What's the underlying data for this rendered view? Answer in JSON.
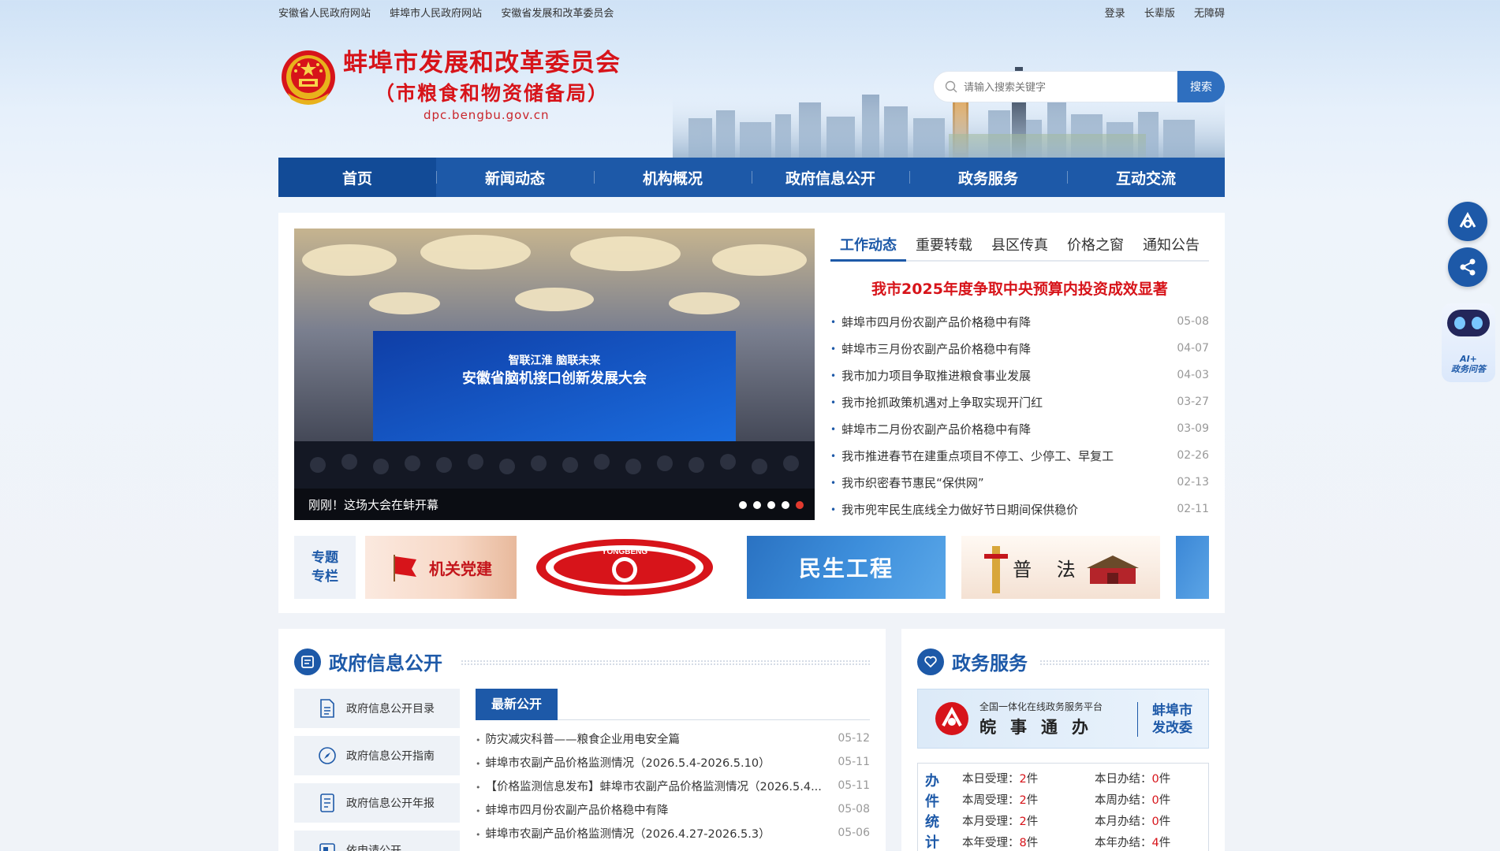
{
  "topbar": {
    "links": [
      "安徽省人民政府网站",
      "蚌埠市人民政府网站",
      "安徽省发展和改革委员会"
    ],
    "login": "登录",
    "elder": "长辈版",
    "accessibility": "无障碍"
  },
  "header": {
    "title": "蚌埠市发展和改革委员会",
    "subtitle": "（市粮食和物资储备局）",
    "domain": "dpc.bengbu.gov.cn",
    "search_placeholder": "请输入搜索关键字",
    "search_button": "搜索"
  },
  "nav": {
    "items": [
      "首页",
      "新闻动态",
      "机构概况",
      "政府信息公开",
      "政务服务",
      "互动交流"
    ],
    "active": 0
  },
  "slider": {
    "caption": "刚刚！这场大会在蚌开幕",
    "screen_line1": "智联江淮  脑联未来",
    "screen_line2": "安徽省脑机接口创新发展大会",
    "dot_count": 5,
    "active_dot": 4
  },
  "news": {
    "tabs": [
      "工作动态",
      "重要转载",
      "县区传真",
      "价格之窗",
      "通知公告"
    ],
    "active_tab": 0,
    "headline": "我市2025年度争取中央预算内投资成效显著",
    "items": [
      {
        "title": "蚌埠市四月份农副产品价格稳中有降",
        "date": "05-08"
      },
      {
        "title": "蚌埠市三月份农副产品价格稳中有降",
        "date": "04-07"
      },
      {
        "title": "我市加力项目争取推进粮食事业发展",
        "date": "04-03"
      },
      {
        "title": "我市抢抓政策机遇对上争取实现开门红",
        "date": "03-27"
      },
      {
        "title": "蚌埠市二月份农副产品价格稳中有降",
        "date": "03-09"
      },
      {
        "title": "我市推进春节在建重点项目不停工、少停工、早复工",
        "date": "02-26"
      },
      {
        "title": "我市织密春节惠民“保供网”",
        "date": "02-13"
      },
      {
        "title": "我市兜牢民生底线全力做好节日期间保供稳价",
        "date": "02-11"
      }
    ]
  },
  "special": {
    "label_line1": "专题",
    "label_line2": "专栏",
    "banners": [
      "机关党建",
      "YONGBENG",
      "民生工程",
      "普 法"
    ]
  },
  "gov_info": {
    "title": "政府信息公开",
    "side": [
      "政府信息公开目录",
      "政府信息公开指南",
      "政府信息公开年报",
      "依申请公开"
    ],
    "latest_tab": "最新公开",
    "items": [
      {
        "title": "防灾减灾科普——粮食企业用电安全篇",
        "date": "05-12"
      },
      {
        "title": "蚌埠市农副产品价格监测情况（2026.5.4-2026.5.10）",
        "date": "05-11"
      },
      {
        "title": "【价格监测信息发布】蚌埠市农副产品价格监测情况（2026.5.4...",
        "date": "05-11"
      },
      {
        "title": "蚌埠市四月份农副产品价格稳中有降",
        "date": "05-08"
      },
      {
        "title": "蚌埠市农副产品价格监测情况（2026.4.27-2026.5.3）",
        "date": "05-06"
      }
    ]
  },
  "service": {
    "title": "政务服务",
    "platform_small": "全国一体化在线政务服务平台",
    "platform_big": "皖事通办",
    "city_line1": "蚌埠市",
    "city_line2": "发改委",
    "stats_label": "办件统计",
    "stats": [
      {
        "label": "本日受理：",
        "value": "2",
        "unit": "件"
      },
      {
        "label": "本日办结：",
        "value": "0",
        "unit": "件"
      },
      {
        "label": "本周受理：",
        "value": "2",
        "unit": "件"
      },
      {
        "label": "本周办结：",
        "value": "0",
        "unit": "件"
      },
      {
        "label": "本月受理：",
        "value": "2",
        "unit": "件"
      },
      {
        "label": "本月办结：",
        "value": "0",
        "unit": "件"
      },
      {
        "label": "本年受理：",
        "value": "8",
        "unit": "件"
      },
      {
        "label": "本年办结：",
        "value": "4",
        "unit": "件"
      }
    ]
  },
  "floating": {
    "ai_label_line1": "AI+",
    "ai_label_line2": "政务问答"
  },
  "colors": {
    "brand_blue": "#1d59a8",
    "title_red": "#d7141a"
  }
}
